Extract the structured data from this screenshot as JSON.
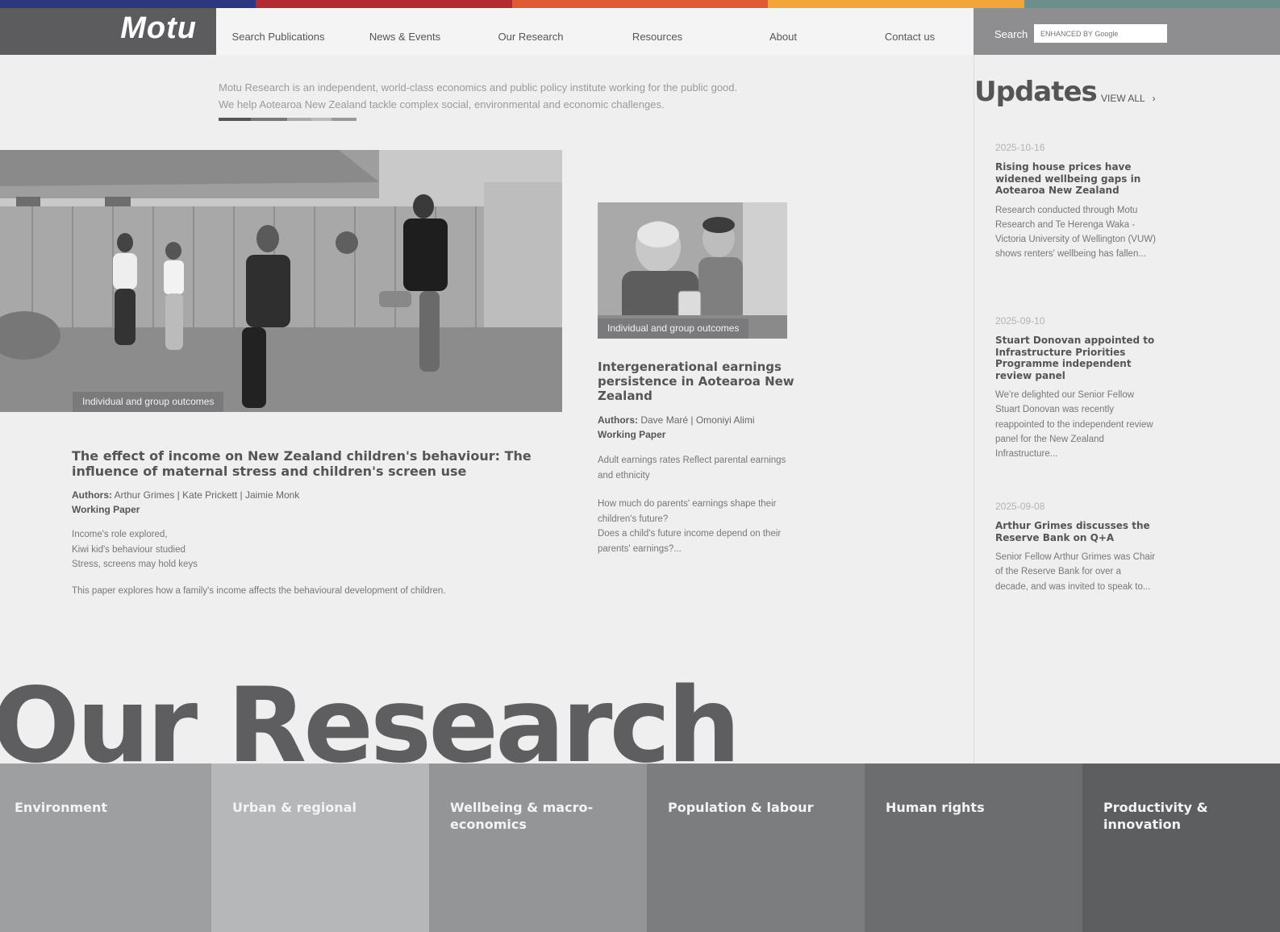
{
  "colors": {
    "bar": [
      "#2d3780",
      "#b32a33",
      "#de5b34",
      "#f3a53a",
      "#6e8e8c"
    ],
    "underline": [
      "#555555",
      "#777777",
      "#aaaaaa",
      "#bbbbbb",
      "#999999"
    ],
    "tiles": [
      "#9e9fa1",
      "#b6b7b9",
      "#949597",
      "#7c7d7f",
      "#6c6d6f",
      "#5d5e60"
    ]
  },
  "header": {
    "logo": "Motu",
    "nav": [
      "Search Publications",
      "News & Events",
      "Our Research",
      "Resources",
      "About",
      "Contact us"
    ],
    "search_label": "Search",
    "search_placeholder": "ENHANCED BY Google"
  },
  "intro": {
    "line1": "Motu Research is an independent, world-class economics and public policy institute working for the public good.",
    "line2": "We help Aotearoa New Zealand tackle complex social, environmental and economic challenges."
  },
  "feature": {
    "tag": "Individual and group outcomes",
    "title": "The effect of income on New Zealand children's behaviour: The influence of maternal stress and children's screen use",
    "authors_label": "Authors:",
    "authors": "Arthur Grimes | Kate Prickett | Jaimie Monk",
    "type": "Working Paper",
    "poem": [
      "Income's role explored,",
      "Kiwi kid's behaviour studied",
      "Stress, screens may hold keys"
    ],
    "summary": "This paper explores how a family's income affects the behavioural development of children."
  },
  "second": {
    "tag": "Individual and group outcomes",
    "title": "Intergenerational earnings persistence in Aotearoa New Zealand",
    "authors_label": "Authors:",
    "authors": "Dave Maré | Omoniyi Alimi",
    "type": "Working Paper",
    "p1": "Adult earnings rates Reflect parental earnings and ethnicity",
    "p2a": "How much do parents' earnings shape their children's future?",
    "p2b": "Does a child's future income depend on their parents' earnings?..."
  },
  "updates": {
    "heading": "Updates",
    "view_all": "VIEW ALL",
    "view_all_arrow": "›",
    "items": [
      {
        "date": "2025-10-16",
        "title": "Rising house prices have widened wellbeing gaps in Aotearoa New Zealand",
        "body": "Research conducted through Motu Research and Te Herenga Waka - Victoria University of Wellington (VUW) shows renters' wellbeing has fallen..."
      },
      {
        "date": "2025-09-10",
        "title": "Stuart Donovan appointed to Infrastructure Priorities Programme independent review panel",
        "body": "We're delighted our Senior Fellow Stuart Donovan was recently reappointed to the independent review panel for the New Zealand Infrastructure..."
      },
      {
        "date": "2025-09-08",
        "title": "Arthur Grimes discusses the Reserve Bank on Q+A",
        "body": "Senior Fellow Arthur Grimes was Chair of the Reserve Bank for over a decade, and was invited to speak to..."
      }
    ]
  },
  "research": {
    "heading": "Our Research",
    "tiles": [
      "Environment",
      "Urban & regional",
      "Wellbeing & macro-economics",
      "Population & labour",
      "Human rights",
      "Productivity & innovation"
    ]
  }
}
